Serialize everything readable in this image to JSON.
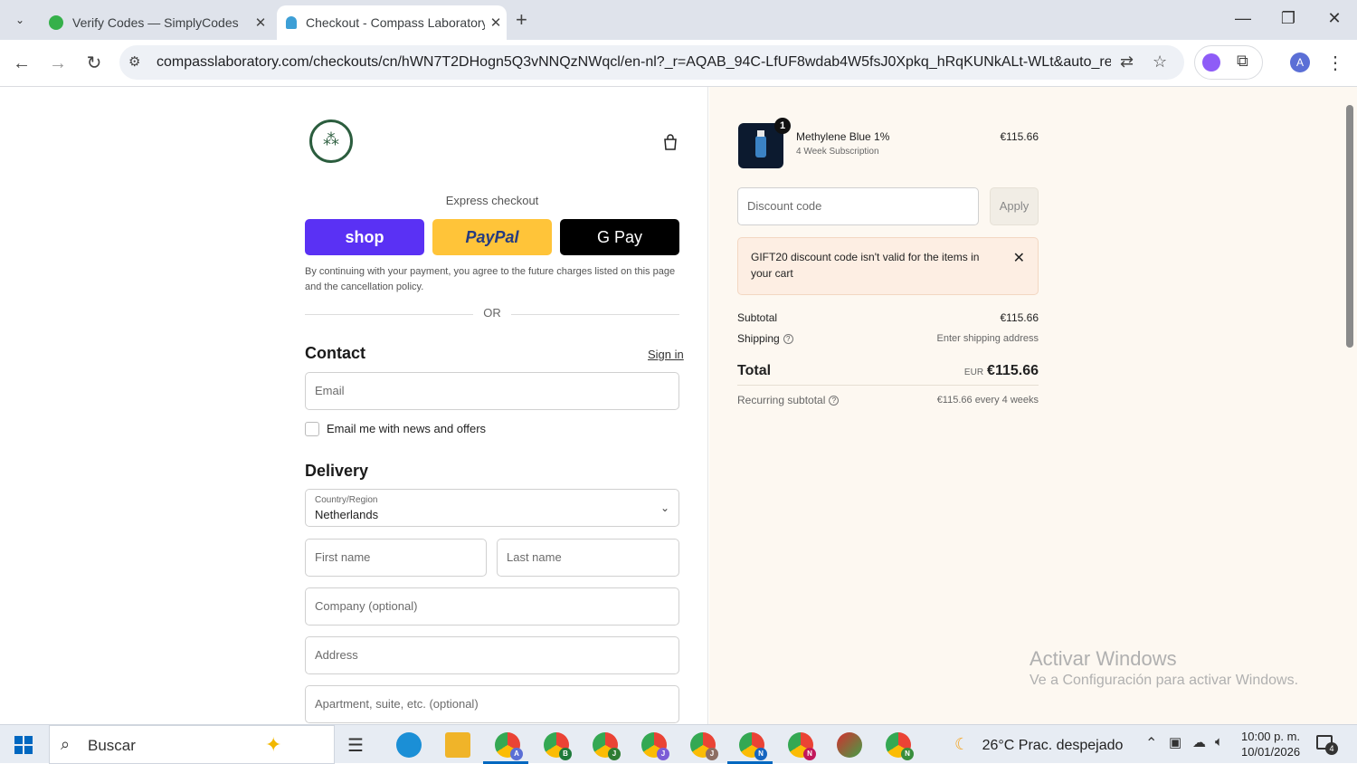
{
  "browser": {
    "tabs": [
      {
        "title": "Verify Codes — SimplyCodes",
        "favicon": "simplycodes-icon",
        "color": "#35b04a"
      },
      {
        "title": "Checkout - Compass Laboratory",
        "favicon": "shopify-icon",
        "color": "#3d9fd6"
      }
    ],
    "url": "compasslaboratory.com/checkouts/cn/hWN7T2DHogn5Q3vNNQzNWqcl/en-nl?_r=AQAB_94C-LfUF8wdab4W5fsJ0Xpkq_hRqKUNkALt-WLt&auto_redirect...",
    "profile_initial": "A"
  },
  "checkout": {
    "express_label": "Express checkout",
    "shop_label": "shop",
    "paypal_label": "PayPal",
    "gpay_label": "G Pay",
    "terms": "By continuing with your payment, you agree to the future charges listed on this page and the cancellation policy.",
    "or_label": "OR",
    "contact_heading": "Contact",
    "sign_in": "Sign in",
    "email_placeholder": "Email",
    "email_offers": "Email me with news and offers",
    "delivery_heading": "Delivery",
    "country_label": "Country/Region",
    "country_value": "Netherlands",
    "first_name": "First name",
    "last_name": "Last name",
    "company": "Company (optional)",
    "address": "Address",
    "apartment": "Apartment, suite, etc. (optional)"
  },
  "summary": {
    "quantity": "1",
    "product_name": "Methylene Blue 1%",
    "product_variant": "4 Week Subscription",
    "product_price": "€115.66",
    "discount_placeholder": "Discount code",
    "apply_label": "Apply",
    "error_message": "GIFT20 discount code isn't valid for the items in your cart",
    "subtotal_label": "Subtotal",
    "subtotal_value": "€115.66",
    "shipping_label": "Shipping",
    "shipping_value": "Enter shipping address",
    "total_label": "Total",
    "currency": "EUR",
    "total_value": "€115.66",
    "recurring_label": "Recurring subtotal",
    "recurring_value": "€115.66 every 4 weeks"
  },
  "watermark": {
    "title": "Activar Windows",
    "subtitle": "Ve a Configuración para activar Windows."
  },
  "taskbar": {
    "search_label": "Buscar",
    "weather": "26°C  Prac. despejado",
    "time": "10:00 p. m.",
    "date": "10/01/2026",
    "notifications": "4",
    "profiles": [
      "A",
      "B",
      "J",
      "J",
      "J",
      "N",
      "N",
      "N"
    ]
  }
}
